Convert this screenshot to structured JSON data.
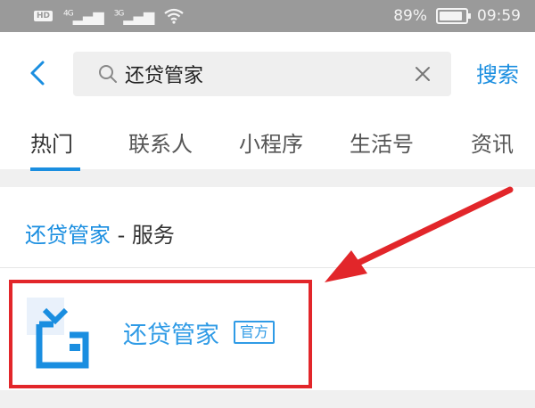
{
  "status_bar": {
    "hd_label": "HD",
    "signal1": "⁴ᴳ…❙",
    "signal1_gen": "4G",
    "signal2_gen": "3G",
    "battery_text": "89%",
    "battery_level": 0.89,
    "time": "09:59"
  },
  "search": {
    "query": "还贷管家",
    "button_label": "搜索"
  },
  "tabs": [
    {
      "label": "热门"
    },
    {
      "label": "联系人"
    },
    {
      "label": "小程序"
    },
    {
      "label": "生活号"
    },
    {
      "label": "资讯"
    }
  ],
  "section": {
    "title_highlight": "还贷管家",
    "title_suffix": " - 服务"
  },
  "result": {
    "name": "还贷管家",
    "badge": "官方"
  },
  "colors": {
    "accent": "#1a8ee0",
    "highlight_frame": "#e2262a",
    "icon_bg": "#e9f1fb"
  },
  "icons": {
    "back": "chevron-left-icon",
    "search": "search-icon",
    "clear": "close-icon",
    "app": "wallet-bag-icon",
    "annotation": "red-arrow-icon"
  }
}
